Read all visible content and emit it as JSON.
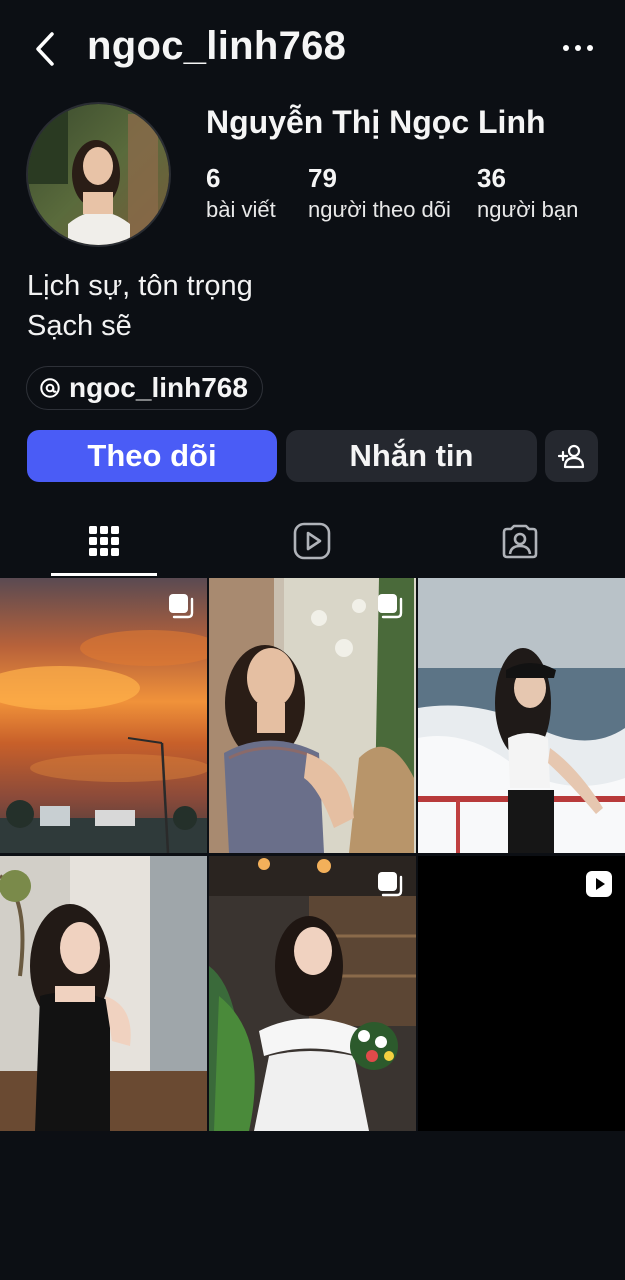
{
  "header": {
    "username": "ngoc_linh768",
    "back_icon": "chevron-left-icon",
    "more_icon": "more-horizontal-icon"
  },
  "profile": {
    "full_name": "Nguyễn Thị Ngọc Linh",
    "stats": [
      {
        "value": "6",
        "label": "bài viết"
      },
      {
        "value": "79",
        "label": "người theo dõi"
      },
      {
        "value": "36",
        "label": "người bạn"
      }
    ],
    "bio": [
      "Lịch sự, tôn trọng",
      "Sạch sẽ"
    ],
    "threads_handle": "ngoc_linh768"
  },
  "actions": {
    "follow_label": "Theo dõi",
    "message_label": "Nhắn tin",
    "add_user_icon": "add-user-icon"
  },
  "tabs": [
    {
      "name": "grid",
      "icon": "grid-icon",
      "active": true
    },
    {
      "name": "reels",
      "icon": "reels-icon",
      "active": false
    },
    {
      "name": "tagged",
      "icon": "tagged-user-icon",
      "active": false
    }
  ],
  "colors": {
    "background": "#0c0f14",
    "accent": "#4a5cf6",
    "button_secondary": "#25282f"
  },
  "posts": [
    {
      "type": "carousel",
      "subject": "sunset-sky"
    },
    {
      "type": "carousel",
      "subject": "girl-plaid-dress"
    },
    {
      "type": "photo",
      "subject": "girl-on-boat"
    },
    {
      "type": "photo",
      "subject": "girl-black-dress"
    },
    {
      "type": "carousel",
      "subject": "girl-white-dress-flowers"
    },
    {
      "type": "reel",
      "subject": "dark-video"
    }
  ]
}
